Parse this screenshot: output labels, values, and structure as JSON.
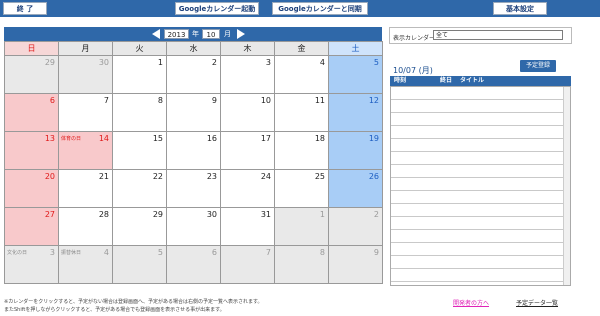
{
  "toolbar": {
    "end_label": "終 了",
    "launch_label": "Googleカレンダー起動",
    "sync_label": "Googleカレンダーと同期",
    "settings_label": "基本設定"
  },
  "calendar": {
    "year": "2013",
    "month": "10",
    "year_suffix": "年",
    "month_suffix": "月",
    "weekdays": [
      "日",
      "月",
      "火",
      "水",
      "木",
      "金",
      "土"
    ],
    "weeks": [
      [
        {
          "d": "29",
          "t": "other"
        },
        {
          "d": "30",
          "t": "other"
        },
        {
          "d": "1"
        },
        {
          "d": "2"
        },
        {
          "d": "3"
        },
        {
          "d": "4"
        },
        {
          "d": "5",
          "t": "sat"
        }
      ],
      [
        {
          "d": "6",
          "t": "sun"
        },
        {
          "d": "7"
        },
        {
          "d": "8"
        },
        {
          "d": "9"
        },
        {
          "d": "10"
        },
        {
          "d": "11"
        },
        {
          "d": "12",
          "t": "sat"
        }
      ],
      [
        {
          "d": "13",
          "t": "sun"
        },
        {
          "d": "14",
          "t": "hol",
          "h": "体育の日"
        },
        {
          "d": "15"
        },
        {
          "d": "16"
        },
        {
          "d": "17"
        },
        {
          "d": "18"
        },
        {
          "d": "19",
          "t": "sat"
        }
      ],
      [
        {
          "d": "20",
          "t": "sun"
        },
        {
          "d": "21"
        },
        {
          "d": "22"
        },
        {
          "d": "23"
        },
        {
          "d": "24"
        },
        {
          "d": "25"
        },
        {
          "d": "26",
          "t": "sat"
        }
      ],
      [
        {
          "d": "27",
          "t": "sun"
        },
        {
          "d": "28"
        },
        {
          "d": "29"
        },
        {
          "d": "30"
        },
        {
          "d": "31"
        },
        {
          "d": "1",
          "t": "other"
        },
        {
          "d": "2",
          "t": "other"
        }
      ],
      [
        {
          "d": "3",
          "t": "other",
          "h": "文化の日"
        },
        {
          "d": "4",
          "t": "other",
          "h": "振替休日"
        },
        {
          "d": "5",
          "t": "other"
        },
        {
          "d": "6",
          "t": "other"
        },
        {
          "d": "7",
          "t": "other"
        },
        {
          "d": "8",
          "t": "other"
        },
        {
          "d": "9",
          "t": "other"
        }
      ]
    ]
  },
  "schedule": {
    "display_label": "表示カレンダー",
    "display_value": "全て",
    "date_label": "10/07 (月)",
    "add_label": "予定登録",
    "col_time": "時刻",
    "col_end": "終日",
    "col_title": "タイトル"
  },
  "footer": {
    "note1": "※カレンダーをクリックすると、予定がない場合は登録画面へ、予定がある場合は右側の予定一覧へ表示されます。",
    "note2": "またShiftを押しながらクリックすると、予定がある場合でも登録画面を表示させる事が出来ます。",
    "dev_link": "開発者の方へ",
    "list_link": "予定データ一覧"
  },
  "colors": {
    "accent": "#2f68a9",
    "sunday": "#f8c9cb",
    "saturday": "#a8cdf6"
  }
}
